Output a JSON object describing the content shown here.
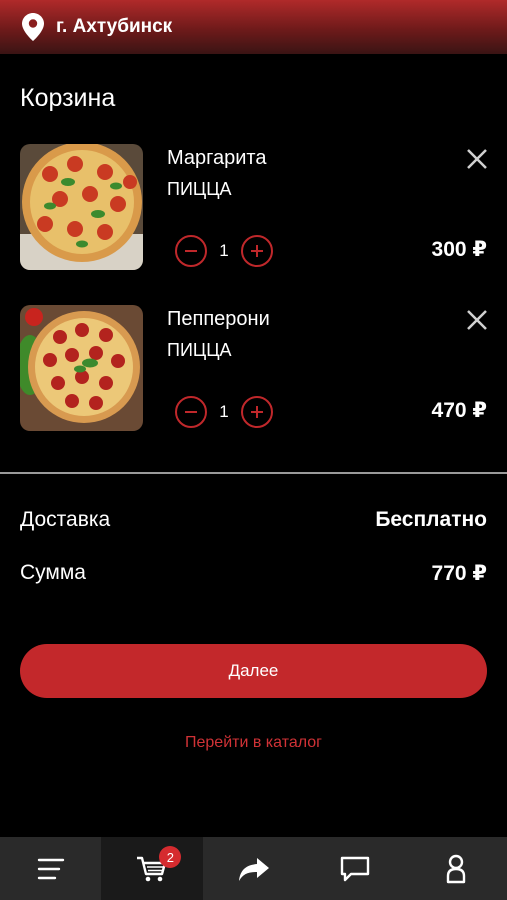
{
  "header": {
    "city": "г. Ахтубинск",
    "icon": "location-pin-icon"
  },
  "page_title": "Корзина",
  "items": [
    {
      "name": "Маргарита",
      "category": "ПИЦЦА",
      "quantity": "1",
      "price": "300 ₽"
    },
    {
      "name": "Пепперони",
      "category": "ПИЦЦА",
      "quantity": "1",
      "price": "470 ₽"
    }
  ],
  "summary": {
    "delivery_label": "Доставка",
    "delivery_value": "Бесплатно",
    "total_label": "Сумма",
    "total_value": "770 ₽"
  },
  "actions": {
    "next_label": "Далее",
    "catalog_link": "Перейти в каталог"
  },
  "tabbar": {
    "tabs": [
      "menu-icon",
      "cart-icon",
      "share-icon",
      "chat-icon",
      "profile-icon"
    ],
    "cart_badge": "2"
  },
  "colors": {
    "accent": "#c3282b",
    "header_red": "#b02a2a",
    "tabbar_bg": "#2a2a2a"
  }
}
